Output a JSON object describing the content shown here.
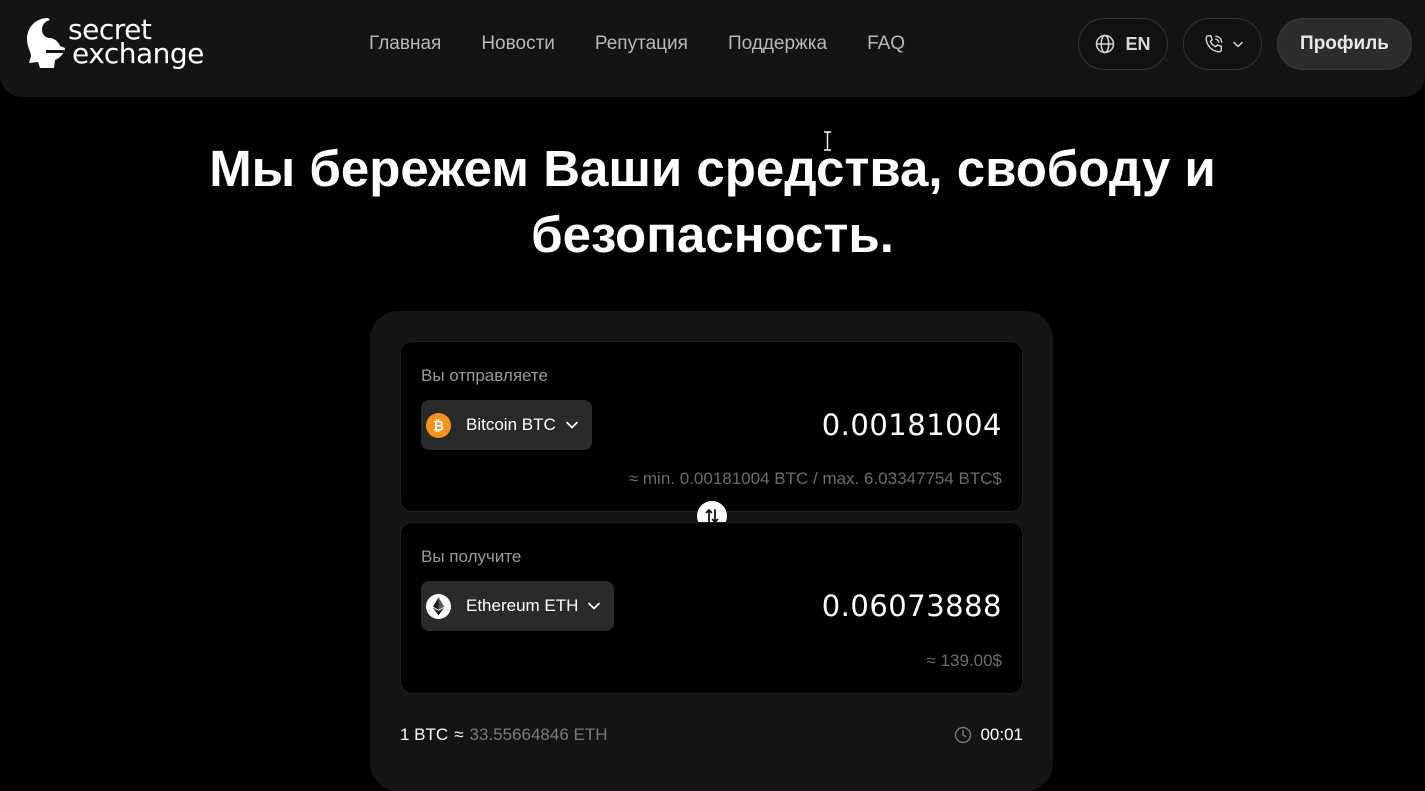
{
  "brand": {
    "line1": "secret",
    "line2": "exchange"
  },
  "nav": [
    "Главная",
    "Новости",
    "Репутация",
    "Поддержка",
    "FAQ"
  ],
  "header": {
    "language": "EN",
    "profile_label": "Профиль",
    "icons": {
      "language": "globe-icon",
      "phone": "phone-icon",
      "dropdown": "chevron-down-icon"
    }
  },
  "hero": {
    "line1": "Мы бережем Ваши средства, свободу и",
    "line2": "безопасность."
  },
  "exchange": {
    "send": {
      "label": "Вы отправляете",
      "coin": "Bitcoin BTC",
      "coin_color": "#f7931a",
      "amount": "0.00181004",
      "hint": "≈ min. 0.00181004 BTC / max. 6.03347754 BTC$"
    },
    "receive": {
      "label": "Вы получите",
      "coin": "Ethereum ETH",
      "coin_color": "#ffffff",
      "amount": "0.06073888",
      "hint": "≈ 139.00$"
    },
    "rate": {
      "base": "1 BTC",
      "approx": "≈",
      "quote": "33.55664846 ETH"
    },
    "timer": "00:01"
  },
  "colors": {
    "background": "#000000",
    "card": "#141414",
    "header": "#141414"
  }
}
